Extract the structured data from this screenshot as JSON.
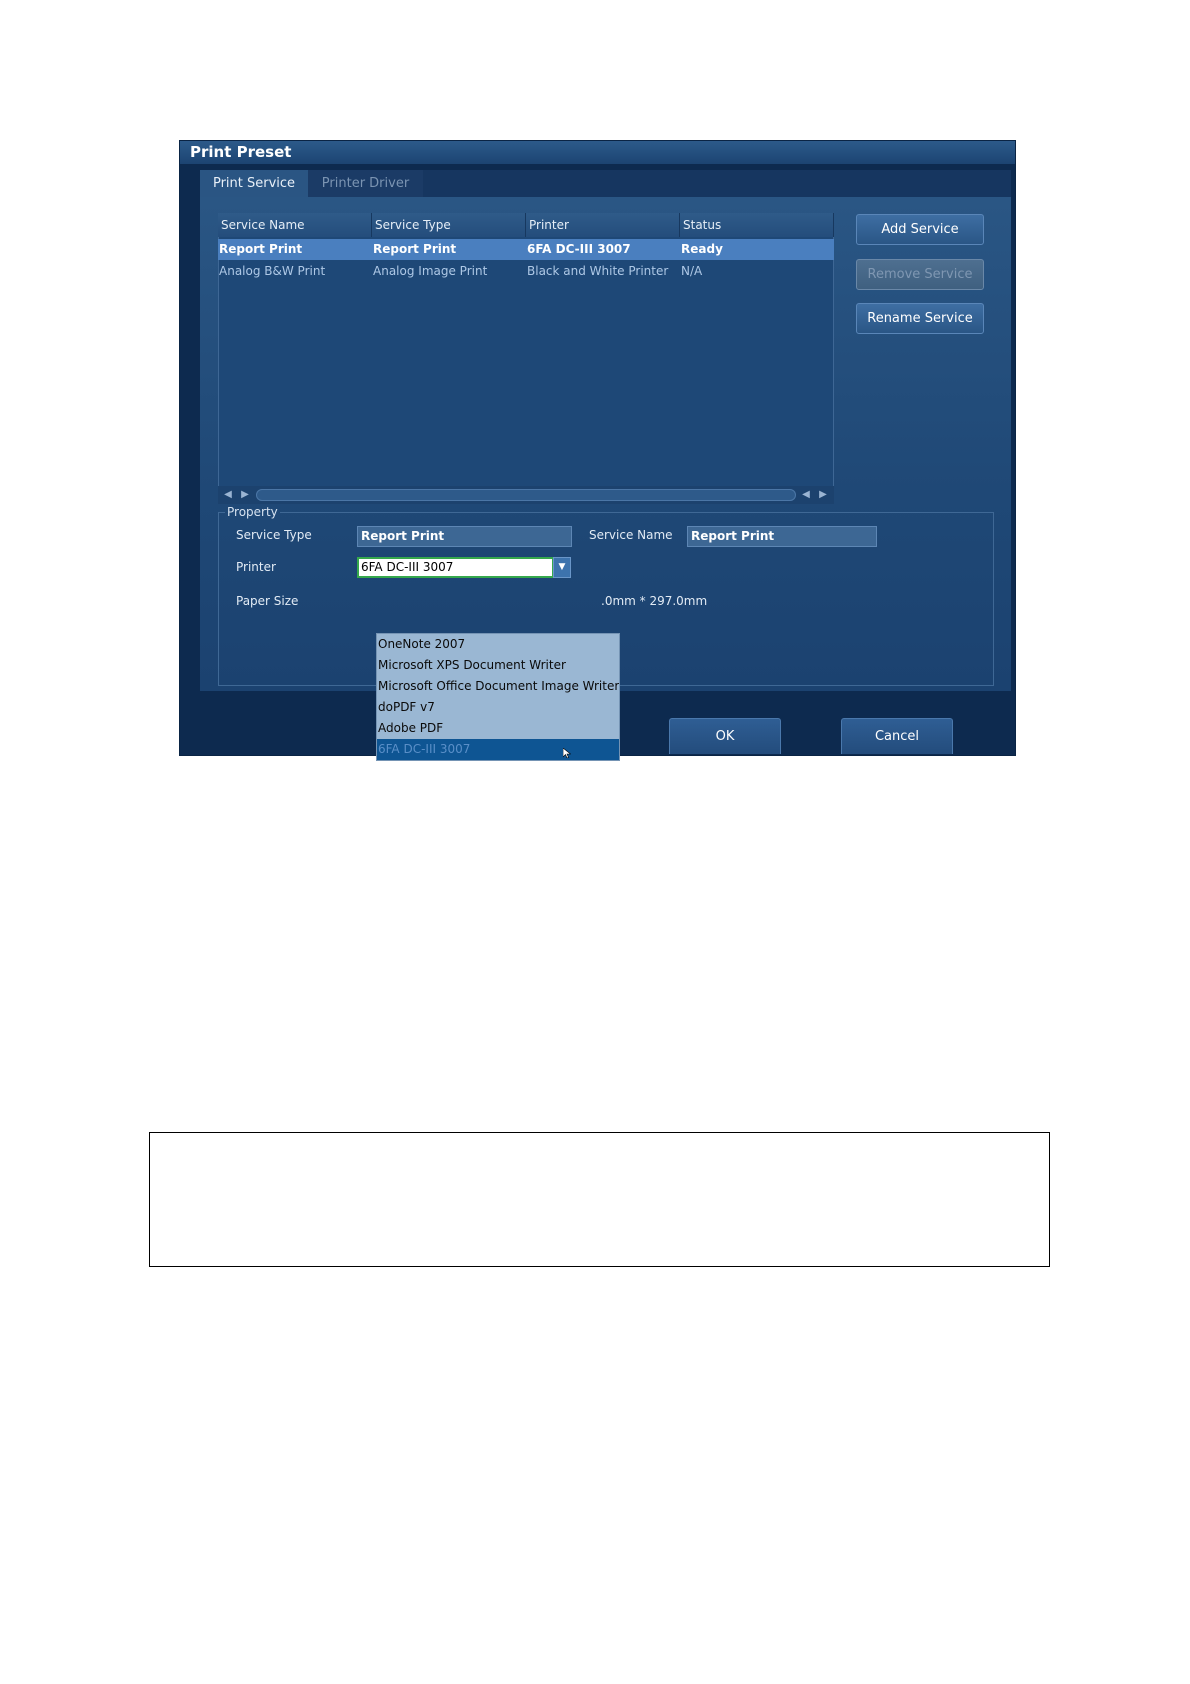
{
  "dialog": {
    "title": "Print Preset",
    "tabs": [
      {
        "label": "Print Service",
        "active": true
      },
      {
        "label": "Printer Driver",
        "active": false
      }
    ]
  },
  "service_table": {
    "columns": [
      "Service Name",
      "Service Type",
      "Printer",
      "Status"
    ],
    "rows": [
      {
        "service_name": "Report Print",
        "service_type": "Report Print",
        "printer": "6FA DC-III 3007",
        "status": "Ready",
        "selected": true
      },
      {
        "service_name": "Analog B&W Print",
        "service_type": "Analog Image Print",
        "printer": "Black and White Printer",
        "status": "N/A",
        "selected": false
      }
    ]
  },
  "side_buttons": {
    "add": "Add Service",
    "remove": "Remove Service",
    "rename": "Rename Service"
  },
  "property": {
    "legend": "Property",
    "service_type_label": "Service Type",
    "service_type_value": "Report Print",
    "service_name_label": "Service Name",
    "service_name_value": "Report Print",
    "printer_label": "Printer",
    "printer_value": "6FA DC-III 3007",
    "paper_size_label": "Paper Size",
    "paper_size_value_visible": ".0mm * 297.0mm"
  },
  "printer_dropdown": {
    "options": [
      "OneNote 2007",
      "Microsoft XPS Document Writer",
      "Microsoft Office Document Image Writer",
      "doPDF v7",
      "Adobe PDF",
      "6FA DC-III 3007"
    ],
    "highlighted_index": 5
  },
  "footer_buttons": {
    "ok": "OK",
    "cancel": "Cancel"
  },
  "colors": {
    "dialog_bg": "#0d2a4f",
    "selected_row": "#4a7fbf",
    "combo_focus_border": "#36a84c",
    "dropdown_bg": "#9ab7d3",
    "dropdown_highlight": "#0e5593"
  }
}
